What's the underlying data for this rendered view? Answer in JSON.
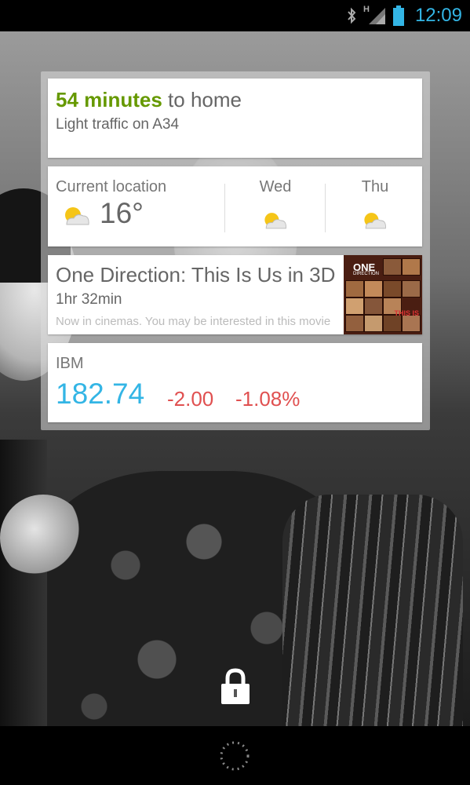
{
  "status_bar": {
    "time": "12:09",
    "network_label": "H",
    "icons": [
      "bluetooth-icon",
      "signal-icon",
      "battery-icon"
    ],
    "accent_color": "#33b5e5"
  },
  "cards": {
    "traffic": {
      "duration": "54 minutes",
      "destination_text": " to home",
      "subtitle": "Light traffic on A34",
      "duration_color": "#669900"
    },
    "weather": {
      "location_label": "Current location",
      "current_temp": "16°",
      "current_icon": "partly-cloudy-icon",
      "days": [
        {
          "label": "Wed",
          "icon": "partly-cloudy-icon"
        },
        {
          "label": "Thu",
          "icon": "partly-cloudy-icon"
        }
      ]
    },
    "movie": {
      "title": "One Direction: This Is Us in 3D",
      "duration": "1hr 32min",
      "description": "Now in cinemas. You may be interested in this movie",
      "poster": {
        "title": "ONE",
        "subtitle": "DIRECTION",
        "tagline": "THIS IS"
      }
    },
    "stock": {
      "ticker": "IBM",
      "price": "182.74",
      "change": "-2.00",
      "change_percent": "-1.08%",
      "price_color": "#33b5e5",
      "negative_color": "#e05050"
    }
  },
  "lockscreen": {
    "lock_icon": "lock-icon",
    "unlock_indicator": "unlock-ring-icon"
  }
}
